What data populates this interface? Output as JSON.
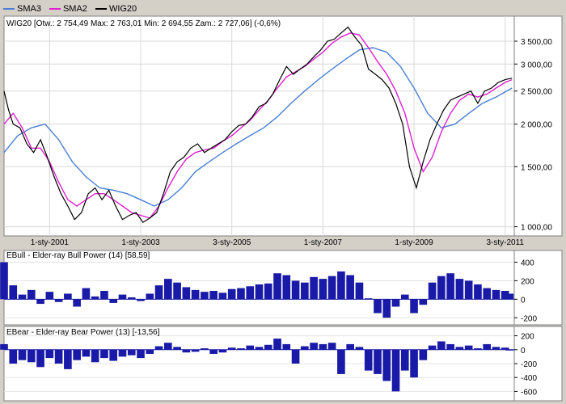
{
  "legend": [
    {
      "label": "SMA3",
      "color": "#4a7fd4"
    },
    {
      "label": "SMA2",
      "color": "#e01fd0"
    },
    {
      "label": "WIG20",
      "color": "#000000"
    }
  ],
  "main_title": "WIG20 [Otw.: 2 754,49   Max: 2 763,01   Min: 2 694,55   Zam.: 2 727,06] (-0,6%)",
  "bull_title": "EBull - Elder-ray Bull Power (14) [58,59]",
  "bear_title": "EBear - Elder-ray Bear Power (13) [-13,56]",
  "chart_data": [
    {
      "type": "line",
      "title": "WIG20 [Otw.: 2 754,49   Max: 2 763,01   Min: 2 694,55   Zam.: 2 727,06] (-0,6%)",
      "y_scale": "log",
      "ylim": [
        950,
        4100
      ],
      "x_range": [
        2000.0,
        2011.2
      ],
      "y_ticks": [
        {
          "value": 1000,
          "label": "1 000,00"
        },
        {
          "value": 1500,
          "label": "1 500,00"
        },
        {
          "value": 2000,
          "label": "2 000,00"
        },
        {
          "value": 2500,
          "label": "2 500,00"
        },
        {
          "value": 3000,
          "label": "3 000,00"
        },
        {
          "value": 3500,
          "label": "3 500,00"
        }
      ],
      "x_ticks": [
        {
          "value": 2001.0,
          "label": "1-sty-2001"
        },
        {
          "value": 2003.0,
          "label": "1-sty-2003"
        },
        {
          "value": 2005.0,
          "label": "3-sty-2005"
        },
        {
          "value": 2007.0,
          "label": "1-sty-2007"
        },
        {
          "value": 2009.0,
          "label": "1-sty-2009"
        },
        {
          "value": 2011.0,
          "label": "3-sty-2011"
        }
      ],
      "series": [
        {
          "name": "WIG20",
          "color": "#000000",
          "x": [
            2000.0,
            2000.1,
            2000.2,
            2000.35,
            2000.5,
            2000.65,
            2000.8,
            2000.95,
            2001.1,
            2001.25,
            2001.4,
            2001.55,
            2001.7,
            2001.85,
            2002.0,
            2002.15,
            2002.3,
            2002.45,
            2002.6,
            2002.75,
            2002.9,
            2003.05,
            2003.2,
            2003.35,
            2003.5,
            2003.65,
            2003.8,
            2003.95,
            2004.1,
            2004.25,
            2004.4,
            2004.55,
            2004.7,
            2004.85,
            2005.0,
            2005.15,
            2005.3,
            2005.45,
            2005.6,
            2005.75,
            2005.9,
            2006.05,
            2006.2,
            2006.35,
            2006.5,
            2006.65,
            2006.8,
            2006.95,
            2007.1,
            2007.25,
            2007.4,
            2007.55,
            2007.7,
            2007.85,
            2008.0,
            2008.15,
            2008.3,
            2008.45,
            2008.6,
            2008.75,
            2008.9,
            2009.05,
            2009.2,
            2009.35,
            2009.5,
            2009.65,
            2009.8,
            2009.95,
            2010.1,
            2010.25,
            2010.4,
            2010.55,
            2010.7,
            2010.85,
            2011.0,
            2011.15
          ],
          "values": [
            2500,
            2200,
            2000,
            1950,
            1750,
            1650,
            1800,
            1600,
            1400,
            1250,
            1150,
            1050,
            1100,
            1250,
            1300,
            1200,
            1280,
            1150,
            1050,
            1080,
            1100,
            1030,
            1060,
            1100,
            1250,
            1450,
            1550,
            1600,
            1700,
            1750,
            1650,
            1700,
            1750,
            1800,
            1900,
            1980,
            2000,
            2100,
            2250,
            2300,
            2450,
            2700,
            2950,
            2800,
            2900,
            3000,
            3150,
            3300,
            3500,
            3550,
            3700,
            3850,
            3600,
            3400,
            2900,
            2800,
            2700,
            2550,
            2300,
            2000,
            1500,
            1300,
            1550,
            1800,
            2000,
            2200,
            2350,
            2400,
            2450,
            2500,
            2300,
            2500,
            2550,
            2650,
            2700,
            2727
          ]
        },
        {
          "name": "SMA2",
          "color": "#e01fd0",
          "x": [
            2000.0,
            2000.2,
            2000.4,
            2000.6,
            2000.8,
            2001.0,
            2001.2,
            2001.4,
            2001.6,
            2001.8,
            2002.0,
            2002.2,
            2002.4,
            2002.6,
            2002.8,
            2003.0,
            2003.2,
            2003.4,
            2003.6,
            2003.8,
            2004.0,
            2004.2,
            2004.4,
            2004.6,
            2004.8,
            2005.0,
            2005.2,
            2005.4,
            2005.6,
            2005.8,
            2006.0,
            2006.2,
            2006.4,
            2006.6,
            2006.8,
            2007.0,
            2007.2,
            2007.4,
            2007.6,
            2007.8,
            2008.0,
            2008.2,
            2008.4,
            2008.6,
            2008.8,
            2009.0,
            2009.2,
            2009.4,
            2009.6,
            2009.8,
            2010.0,
            2010.2,
            2010.4,
            2010.6,
            2010.8,
            2011.0,
            2011.15
          ],
          "values": [
            2000,
            2150,
            1950,
            1700,
            1700,
            1550,
            1350,
            1200,
            1150,
            1200,
            1250,
            1250,
            1200,
            1150,
            1100,
            1080,
            1060,
            1150,
            1300,
            1450,
            1580,
            1650,
            1680,
            1700,
            1780,
            1850,
            1950,
            2050,
            2200,
            2350,
            2550,
            2750,
            2850,
            2950,
            3100,
            3250,
            3450,
            3600,
            3700,
            3650,
            3350,
            3050,
            2800,
            2500,
            2150,
            1700,
            1450,
            1600,
            1900,
            2150,
            2350,
            2450,
            2400,
            2450,
            2550,
            2650,
            2700
          ]
        },
        {
          "name": "SMA3",
          "color": "#4a7fd4",
          "x": [
            2000.0,
            2000.3,
            2000.6,
            2000.9,
            2001.2,
            2001.5,
            2001.8,
            2002.1,
            2002.4,
            2002.7,
            2003.0,
            2003.3,
            2003.6,
            2003.9,
            2004.2,
            2004.5,
            2004.8,
            2005.1,
            2005.4,
            2005.7,
            2006.0,
            2006.3,
            2006.6,
            2006.9,
            2007.2,
            2007.5,
            2007.8,
            2008.1,
            2008.4,
            2008.7,
            2009.0,
            2009.3,
            2009.6,
            2009.9,
            2010.2,
            2010.5,
            2010.8,
            2011.15
          ],
          "values": [
            1650,
            1850,
            1950,
            2000,
            1800,
            1550,
            1400,
            1300,
            1280,
            1250,
            1200,
            1150,
            1200,
            1300,
            1450,
            1550,
            1650,
            1750,
            1850,
            1950,
            2100,
            2300,
            2500,
            2700,
            2900,
            3100,
            3300,
            3350,
            3250,
            2950,
            2550,
            2150,
            1950,
            2000,
            2150,
            2300,
            2400,
            2550
          ]
        }
      ]
    },
    {
      "type": "bar",
      "title": "EBull - Elder-ray Bull Power (14) [58,59]",
      "ylim": [
        -250,
        500
      ],
      "y_ticks": [
        {
          "value": 400,
          "label": "400"
        },
        {
          "value": 200,
          "label": "200"
        },
        {
          "value": 0,
          "label": "0"
        },
        {
          "value": -200,
          "label": "-200"
        }
      ],
      "x": [
        2000.0,
        2000.2,
        2000.4,
        2000.6,
        2000.8,
        2001.0,
        2001.2,
        2001.4,
        2001.6,
        2001.8,
        2002.0,
        2002.2,
        2002.4,
        2002.6,
        2002.8,
        2003.0,
        2003.2,
        2003.4,
        2003.6,
        2003.8,
        2004.0,
        2004.2,
        2004.4,
        2004.6,
        2004.8,
        2005.0,
        2005.2,
        2005.4,
        2005.6,
        2005.8,
        2006.0,
        2006.2,
        2006.4,
        2006.6,
        2006.8,
        2007.0,
        2007.2,
        2007.4,
        2007.6,
        2007.8,
        2008.0,
        2008.2,
        2008.4,
        2008.6,
        2008.8,
        2009.0,
        2009.2,
        2009.4,
        2009.6,
        2009.8,
        2010.0,
        2010.2,
        2010.4,
        2010.6,
        2010.8,
        2011.0,
        2011.1
      ],
      "values": [
        400,
        150,
        50,
        100,
        -50,
        80,
        -30,
        60,
        -80,
        120,
        30,
        90,
        -40,
        50,
        20,
        -20,
        60,
        150,
        220,
        180,
        130,
        100,
        80,
        90,
        70,
        110,
        120,
        140,
        160,
        170,
        280,
        260,
        200,
        180,
        240,
        220,
        250,
        300,
        260,
        180,
        10,
        -150,
        -200,
        -80,
        50,
        -150,
        -60,
        180,
        250,
        280,
        220,
        200,
        160,
        120,
        100,
        90,
        60
      ],
      "color": "#1a1aa8"
    },
    {
      "type": "bar",
      "title": "EBear - Elder-ray Bear Power (13) [-13,56]",
      "ylim": [
        -700,
        300
      ],
      "y_ticks": [
        {
          "value": 200,
          "label": "200"
        },
        {
          "value": 0,
          "label": "0"
        },
        {
          "value": -200,
          "label": "-200"
        },
        {
          "value": -400,
          "label": "-400"
        },
        {
          "value": -600,
          "label": "-600"
        }
      ],
      "x": [
        2000.0,
        2000.2,
        2000.4,
        2000.6,
        2000.8,
        2001.0,
        2001.2,
        2001.4,
        2001.6,
        2001.8,
        2002.0,
        2002.2,
        2002.4,
        2002.6,
        2002.8,
        2003.0,
        2003.2,
        2003.4,
        2003.6,
        2003.8,
        2004.0,
        2004.2,
        2004.4,
        2004.6,
        2004.8,
        2005.0,
        2005.2,
        2005.4,
        2005.6,
        2005.8,
        2006.0,
        2006.2,
        2006.4,
        2006.6,
        2006.8,
        2007.0,
        2007.2,
        2007.4,
        2007.6,
        2007.8,
        2008.0,
        2008.2,
        2008.4,
        2008.6,
        2008.8,
        2009.0,
        2009.2,
        2009.4,
        2009.6,
        2009.8,
        2010.0,
        2010.2,
        2010.4,
        2010.6,
        2010.8,
        2011.0,
        2011.1
      ],
      "values": [
        80,
        -200,
        -150,
        -180,
        -250,
        -120,
        -200,
        -280,
        -150,
        -100,
        -180,
        -120,
        -160,
        -100,
        -80,
        -120,
        -60,
        50,
        100,
        40,
        -40,
        -30,
        20,
        -60,
        -40,
        30,
        20,
        60,
        40,
        70,
        160,
        80,
        -200,
        50,
        100,
        80,
        100,
        -350,
        80,
        40,
        -300,
        -350,
        -450,
        -600,
        -300,
        -400,
        -150,
        60,
        120,
        80,
        40,
        60,
        20,
        80,
        40,
        30,
        0
      ],
      "color": "#1a1aa8"
    }
  ]
}
